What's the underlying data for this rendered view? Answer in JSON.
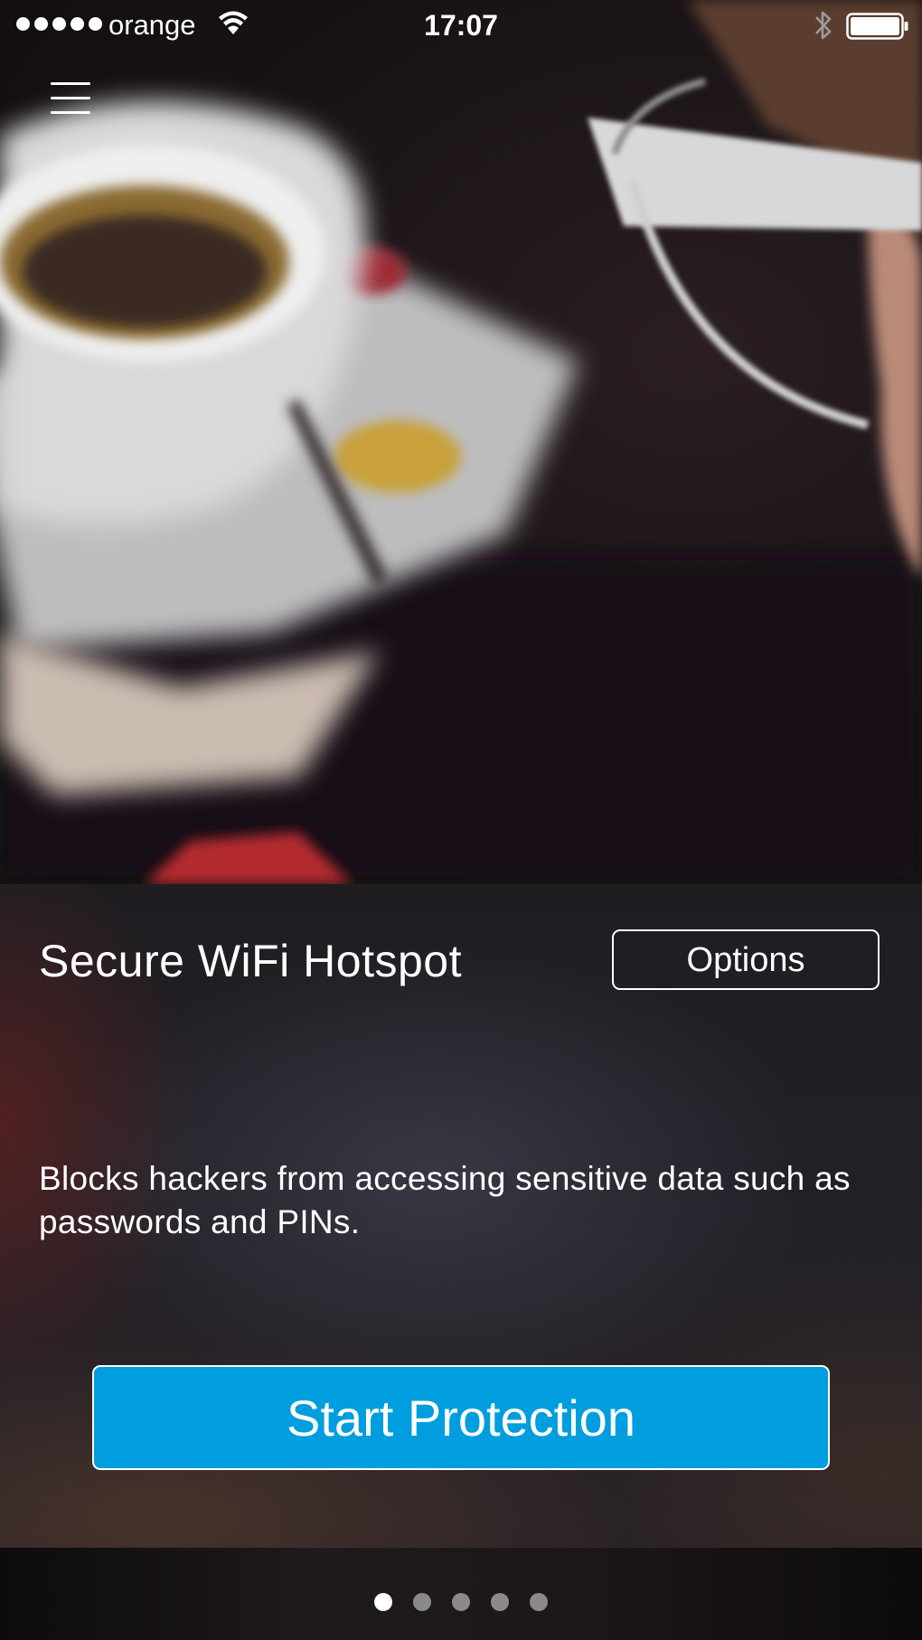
{
  "status_bar": {
    "carrier": "orange",
    "time": "17:07",
    "signal_dots": 5,
    "icons": [
      "wifi-icon",
      "bluetooth-icon",
      "battery-icon"
    ]
  },
  "header": {
    "menu_icon": "hamburger-menu-icon"
  },
  "feature": {
    "title": "Secure WiFi Hotspot",
    "options_label": "Options",
    "description": "Blocks hackers from accessing sensitive data such as passwords and PINs.",
    "start_label": "Start Protection"
  },
  "pagination": {
    "total": 5,
    "active_index": 0
  },
  "colors": {
    "accent": "#009ede",
    "text": "#ffffff",
    "dot_inactive": "#8a8a8c"
  }
}
